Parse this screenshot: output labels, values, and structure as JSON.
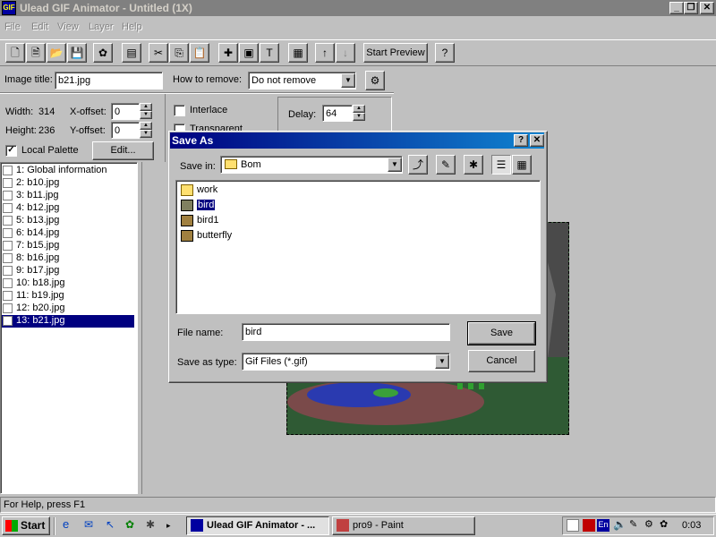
{
  "window": {
    "title": "Ulead GIF Animator - Untitled (1X)"
  },
  "menu": [
    "File",
    "Edit",
    "View",
    "Layer",
    "Help"
  ],
  "toolbar": {
    "start_preview": "Start Preview"
  },
  "props": {
    "image_title_label": "Image title:",
    "image_title_value": "b21.jpg",
    "how_to_remove_label": "How to remove:",
    "how_to_remove_value": "Do not remove",
    "width_label": "Width:",
    "width_value": "314",
    "height_label": "Height:",
    "height_value": "236",
    "xoffset_label": "X-offset:",
    "xoffset_value": "0",
    "yoffset_label": "Y-offset:",
    "yoffset_value": "0",
    "interlace_label": "Interlace",
    "transparent_label": "Transparent index",
    "delay_label": "Delay:",
    "delay_value": "64",
    "local_palette_label": "Local Palette",
    "edit_button": "Edit..."
  },
  "frames": [
    "1: Global information",
    "2: b10.jpg",
    "3: b11.jpg",
    "4: b12.jpg",
    "5: b13.jpg",
    "6: b14.jpg",
    "7: b15.jpg",
    "8: b16.jpg",
    "9: b17.jpg",
    "10: b18.jpg",
    "11: b19.jpg",
    "12: b20.jpg",
    "13: b21.jpg"
  ],
  "dialog": {
    "title": "Save As",
    "save_in_label": "Save in:",
    "save_in_value": "Bom",
    "files": [
      {
        "name": "work",
        "type": "folder"
      },
      {
        "name": "bird",
        "type": "gif"
      },
      {
        "name": "bird1",
        "type": "gif"
      },
      {
        "name": "butterfly",
        "type": "gif"
      }
    ],
    "file_name_label": "File name:",
    "file_name_value": "bird",
    "save_as_type_label": "Save as type:",
    "save_as_type_value": "Gif Files (*.gif)",
    "save_button": "Save",
    "cancel_button": "Cancel"
  },
  "status": "For Help, press F1",
  "taskbar": {
    "start": "Start",
    "tasks": [
      "Ulead GIF Animator - ...",
      "pro9 - Paint"
    ],
    "clock": "0:03"
  },
  "colors": {
    "selection": "#000080",
    "face": "#c0c0c0",
    "title_active": "#000080"
  }
}
